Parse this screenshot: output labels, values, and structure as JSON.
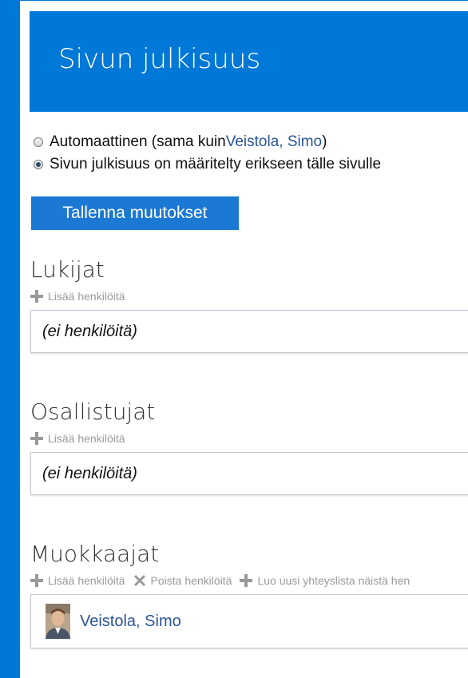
{
  "header": {
    "title": "Sivun julkisuus"
  },
  "visibility": {
    "option_auto_prefix": "Automaattinen (sama kuin ",
    "option_auto_link": "Veistola, Simo",
    "option_auto_suffix": ")",
    "option_custom": "Sivun julkisuus on määritelty erikseen tälle sivulle",
    "selected": "custom"
  },
  "save_button": "Tallenna muutokset",
  "sections": {
    "readers": {
      "title": "Lukijat",
      "add_label": "Lisää henkilöitä",
      "empty_text": "(ei henkilöitä)"
    },
    "participants": {
      "title": "Osallistujat",
      "add_label": "Lisää henkilöitä",
      "empty_text": "(ei henkilöitä)"
    },
    "editors": {
      "title": "Muokkaajat",
      "add_label": "Lisää henkilöitä",
      "remove_label": "Poista henkilöitä",
      "create_list_label": "Luo uusi yhteyslista näistä hen",
      "people": [
        {
          "name": "Veistola, Simo",
          "icon": "avatar-photo"
        }
      ]
    }
  },
  "colors": {
    "accent": "#0078d7",
    "link": "#2a5599",
    "muted": "#9a9a9a"
  }
}
